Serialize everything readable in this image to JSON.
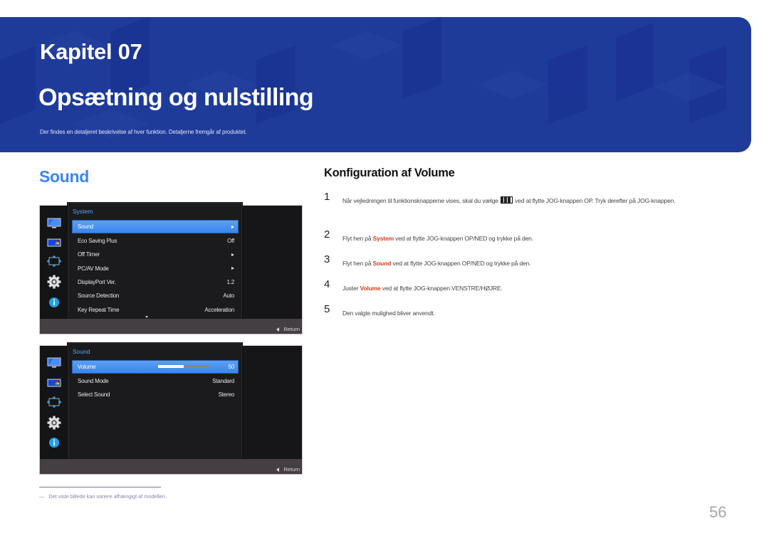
{
  "banner": {
    "chapter": "Kapitel 07",
    "title": "Opsætning og nulstilling",
    "subtitle": "Der findes en detaljeret beskrivelse af hver funktion. Detaljerne fremgår af produktet.",
    "background_color": "#1f3b9a"
  },
  "section": {
    "title": "Sound",
    "title_color": "#3a86f5"
  },
  "osd_system": {
    "panel_title": "System",
    "sidebar_icons": [
      "picture-icon",
      "color-icon",
      "size-position-icon",
      "system-gear-icon",
      "info-icon"
    ],
    "items": [
      {
        "label": "Sound",
        "value": "",
        "arrow": true,
        "selected": true
      },
      {
        "label": "Eco Saving Plus",
        "value": "Off",
        "arrow": false,
        "selected": false
      },
      {
        "label": "Off Timer",
        "value": "",
        "arrow": true,
        "selected": false
      },
      {
        "label": "PC/AV Mode",
        "value": "",
        "arrow": true,
        "selected": false
      },
      {
        "label": "DisplayPort Ver.",
        "value": "1.2",
        "arrow": false,
        "selected": false
      },
      {
        "label": "Source Detection",
        "value": "Auto",
        "arrow": false,
        "selected": false
      },
      {
        "label": "Key Repeat Time",
        "value": "Acceleration",
        "arrow": false,
        "selected": false
      }
    ],
    "return_label": "Return"
  },
  "osd_sound": {
    "panel_title": "Sound",
    "sidebar_icons": [
      "picture-icon",
      "color-icon",
      "size-position-icon",
      "system-gear-icon",
      "info-icon"
    ],
    "items": [
      {
        "label": "Volume",
        "value": "50",
        "selected": true,
        "slider_percent": 50
      },
      {
        "label": "Sound Mode",
        "value": "Standard",
        "selected": false
      },
      {
        "label": "Select Sound",
        "value": "Stereo",
        "selected": false
      }
    ],
    "return_label": "Return"
  },
  "instructions": {
    "title": "Konfiguration af Volume",
    "highlight_color": "#d93c1e",
    "steps": [
      {
        "num": "1",
        "before": "Når vejledningen til funktionsknapperne vises, skal du vælge ",
        "icon": "menu-button-icon",
        "after": " ved at flytte JOG-knappen OP. Tryk derefter på JOG-knappen."
      },
      {
        "num": "2",
        "before": "Flyt hen på ",
        "highlight": "System",
        "after": " ved at flytte JOG-knappen OP/NED og trykke på den."
      },
      {
        "num": "3",
        "before": "Flyt hen på ",
        "highlight": "Sound",
        "after": " ved at flytte JOG-knappen OP/NED og trykke på den."
      },
      {
        "num": "4",
        "before": "Juster ",
        "highlight": "Volume",
        "after": " ved at flytte JOG-knappen VENSTRE/HØJRE."
      },
      {
        "num": "5",
        "before": "Den valgte mulighed bliver anvendt.",
        "highlight": "",
        "after": ""
      }
    ]
  },
  "footnote": {
    "dash": "―",
    "text": "Det viste billede kan variere afhængigt af modellen."
  },
  "page_number": "56"
}
